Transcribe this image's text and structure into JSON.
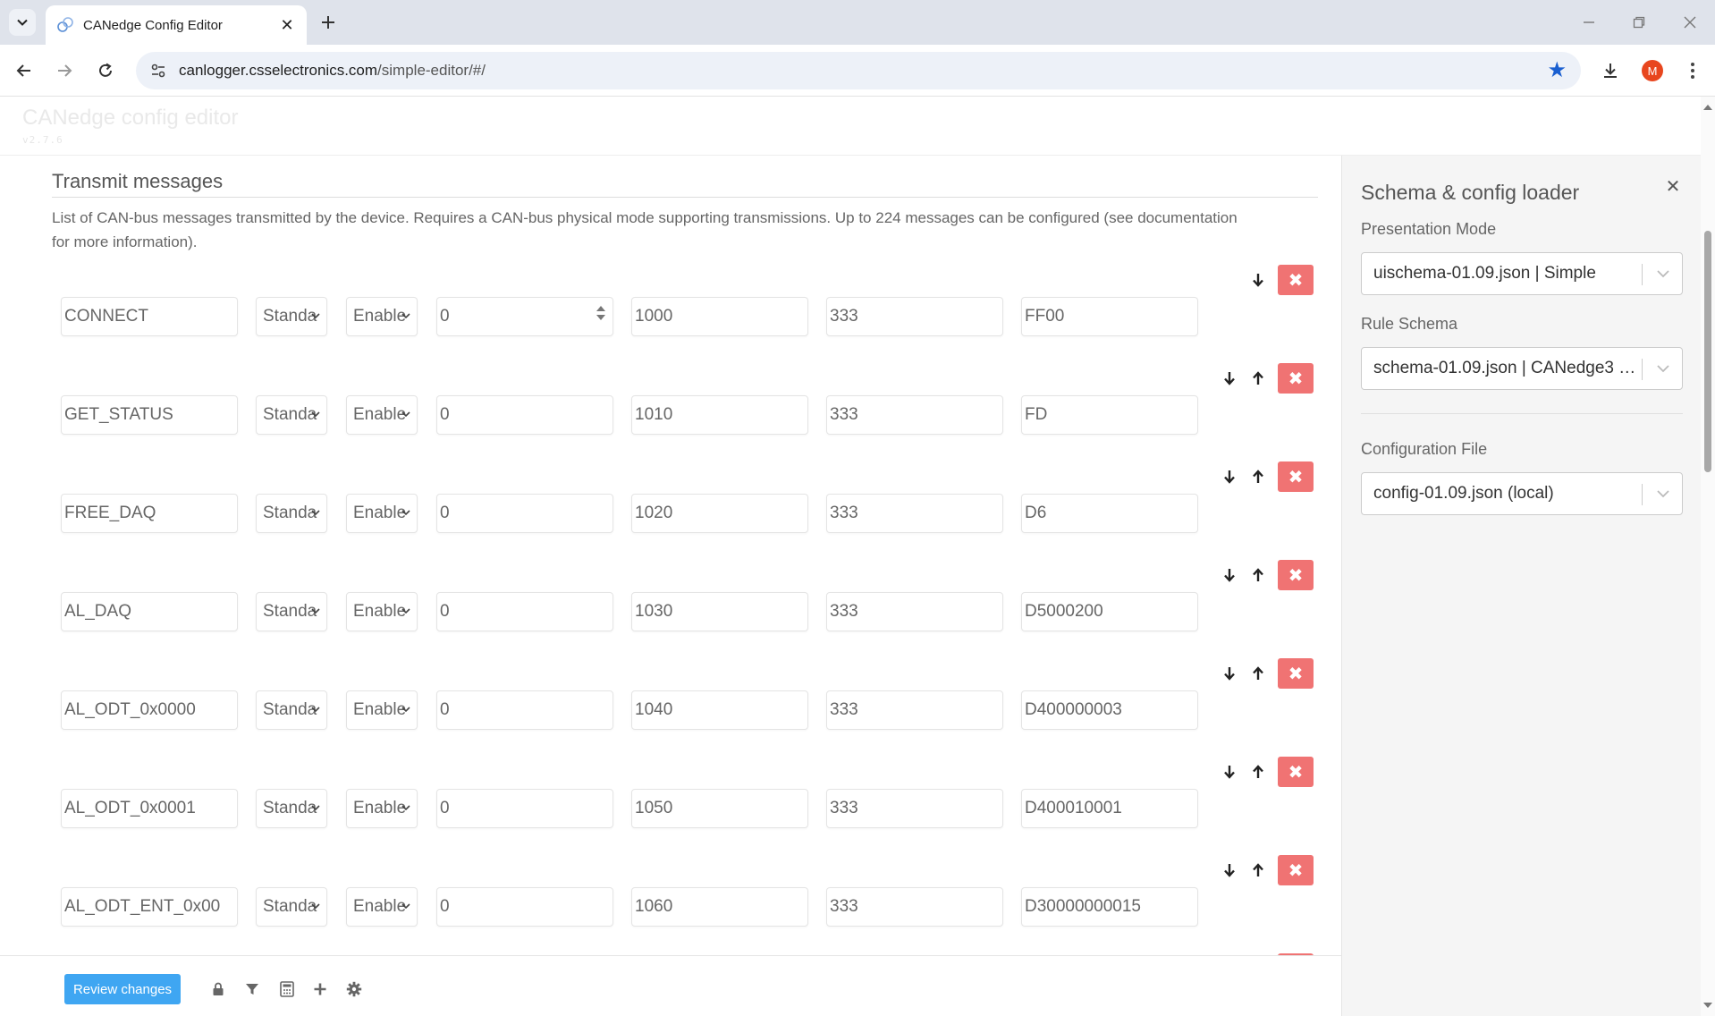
{
  "browser": {
    "tab_title": "CANedge Config Editor",
    "url_host": "canlogger.csselectronics.com",
    "url_path": "/simple-editor/#/",
    "profile_initial": "M",
    "accent_color": "#1a5fd0"
  },
  "app": {
    "title": "CANedge config editor",
    "version": "v2.7.6"
  },
  "section": {
    "title": "Transmit messages",
    "description": "List of CAN-bus messages transmitted by the device. Requires a CAN-bus physical mode supporting transmissions. Up to 224 messages can be configured (see documentation for more information)."
  },
  "messages": [
    {
      "name": "CONNECT",
      "frame_type": "Standa",
      "state": "Enable",
      "delay": "0",
      "period": "1000",
      "id": "333",
      "data": "FF00"
    },
    {
      "name": "GET_STATUS",
      "frame_type": "Standa",
      "state": "Enable",
      "delay": "0",
      "period": "1010",
      "id": "333",
      "data": "FD"
    },
    {
      "name": "FREE_DAQ",
      "frame_type": "Standa",
      "state": "Enable",
      "delay": "0",
      "period": "1020",
      "id": "333",
      "data": "D6"
    },
    {
      "name": "AL_DAQ",
      "frame_type": "Standa",
      "state": "Enable",
      "delay": "0",
      "period": "1030",
      "id": "333",
      "data": "D5000200"
    },
    {
      "name": "AL_ODT_0x0000",
      "frame_type": "Standa",
      "state": "Enable",
      "delay": "0",
      "period": "1040",
      "id": "333",
      "data": "D400000003"
    },
    {
      "name": "AL_ODT_0x0001",
      "frame_type": "Standa",
      "state": "Enable",
      "delay": "0",
      "period": "1050",
      "id": "333",
      "data": "D400010001"
    },
    {
      "name": "AL_ODT_ENT_0x00",
      "frame_type": "Standa",
      "state": "Enable",
      "delay": "0",
      "period": "1060",
      "id": "333",
      "data": "D30000000015"
    }
  ],
  "bottom_bar": {
    "review_label": "Review changes",
    "review_color": "#3fa6f2",
    "icons": [
      "lock-icon",
      "filter-icon",
      "calculator-icon",
      "plus-icon",
      "gear-icon"
    ]
  },
  "side_panel": {
    "title": "Schema & config loader",
    "presentation_label": "Presentation Mode",
    "presentation_value": "uischema-01.09.json | Simple",
    "rule_label": "Rule Schema",
    "rule_value": "schema-01.09.json | CANedge3 G...",
    "config_label": "Configuration File",
    "config_value": "config-01.09.json (local)"
  },
  "colors": {
    "delete_button": "#f07373",
    "tabbar": "#dfe3eb"
  }
}
